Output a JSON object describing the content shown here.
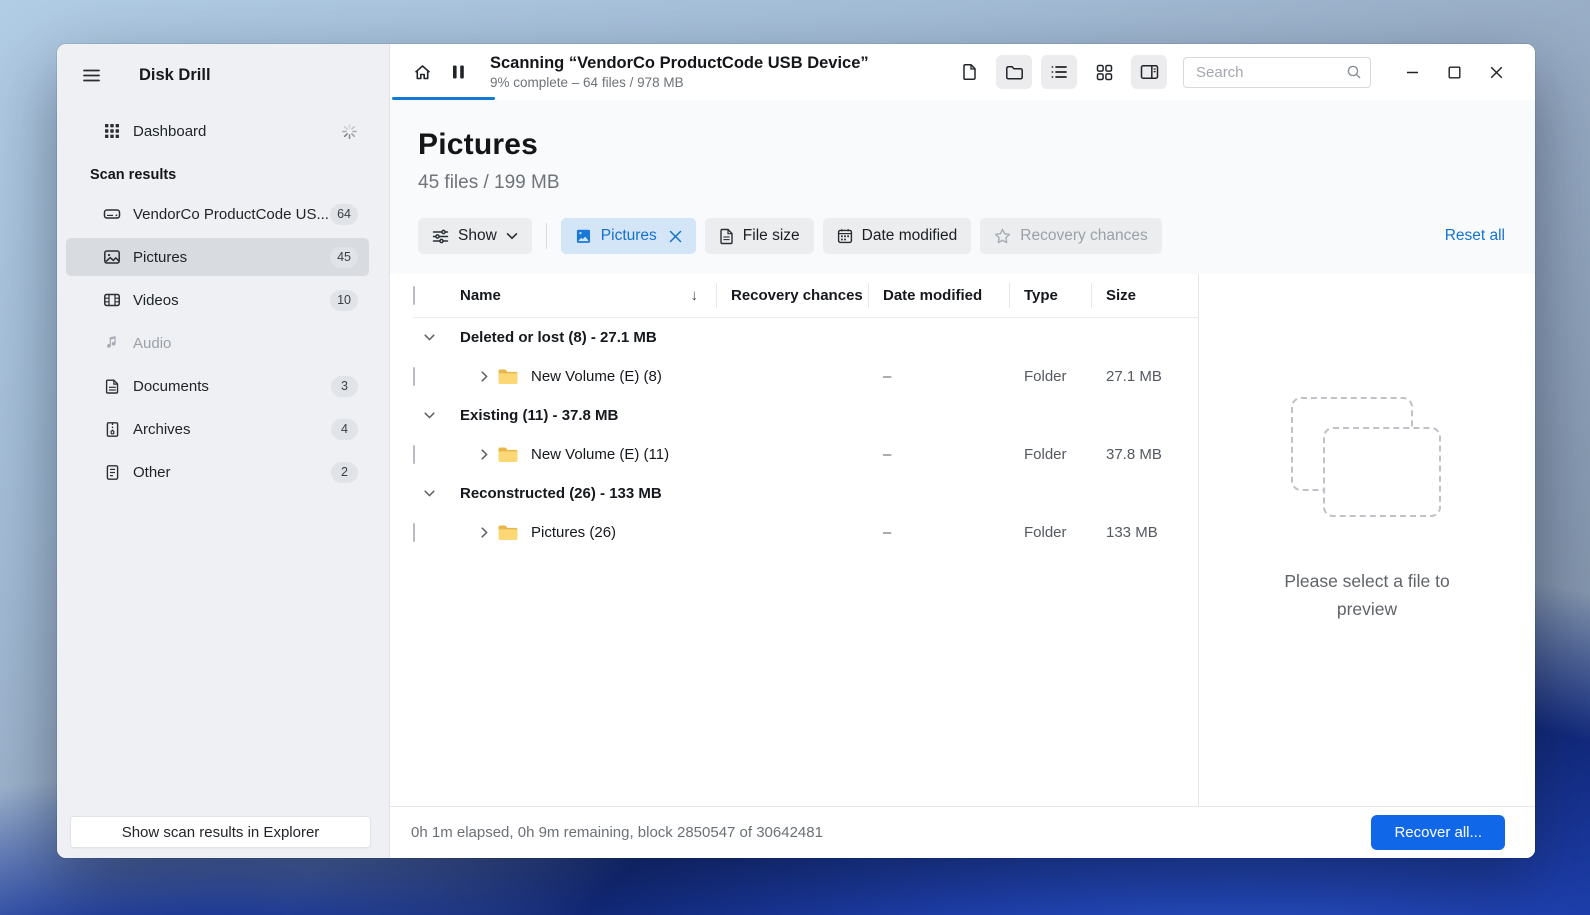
{
  "window": {
    "app_title": "Disk Drill"
  },
  "sidebar": {
    "title": "Disk Drill",
    "dashboard_label": "Dashboard",
    "section_label": "Scan results",
    "items": [
      {
        "label": "VendorCo ProductCode US...",
        "count": "64"
      },
      {
        "label": "Pictures",
        "count": "45"
      },
      {
        "label": "Videos",
        "count": "10"
      },
      {
        "label": "Audio",
        "count": ""
      },
      {
        "label": "Documents",
        "count": "3"
      },
      {
        "label": "Archives",
        "count": "4"
      },
      {
        "label": "Other",
        "count": "2"
      }
    ],
    "bottom_button": "Show scan results in Explorer"
  },
  "toolbar": {
    "scan_title": "Scanning “VendorCo ProductCode USB Device”",
    "scan_subtitle": "9% complete – 64 files / 978 MB",
    "progress_percent": 9,
    "search_placeholder": "Search"
  },
  "header": {
    "title": "Pictures",
    "subtitle": "45 files / 199 MB"
  },
  "filters": {
    "show_label": "Show",
    "chips": [
      {
        "label": "Pictures"
      },
      {
        "label": "File size"
      },
      {
        "label": "Date modified"
      },
      {
        "label": "Recovery chances"
      }
    ],
    "reset_label": "Reset all"
  },
  "table": {
    "columns": [
      "Name",
      "Recovery chances",
      "Date modified",
      "Type",
      "Size"
    ],
    "sort_glyph": "↓",
    "groups": [
      {
        "label": "Deleted or lost (8) - 27.1 MB",
        "rows": [
          {
            "name": "New Volume (E) (8)",
            "recovery": "",
            "date_modified": "–",
            "type": "Folder",
            "size": "27.1 MB"
          }
        ]
      },
      {
        "label": "Existing (11) - 37.8 MB",
        "rows": [
          {
            "name": "New Volume (E) (11)",
            "recovery": "",
            "date_modified": "–",
            "type": "Folder",
            "size": "37.8 MB"
          }
        ]
      },
      {
        "label": "Reconstructed (26) - 133 MB",
        "rows": [
          {
            "name": "Pictures (26)",
            "recovery": "",
            "date_modified": "–",
            "type": "Folder",
            "size": "133 MB"
          }
        ]
      }
    ]
  },
  "preview": {
    "placeholder": "Please select a file to preview"
  },
  "status_bar": {
    "text": "0h 1m elapsed, 0h 9m remaining, block 2850547 of 30642481",
    "recover_button": "Recover all..."
  },
  "colors": {
    "accent_blue": "#1173d4",
    "progress_blue": "#1378d8",
    "recover_button_blue": "#1068e8",
    "chip_active_bg": "#d5e5f8",
    "sidebar_bg": "#eef0f3",
    "selected_item_bg": "#d8dbdf",
    "folder_icon_yellow": "#f9d06a"
  }
}
